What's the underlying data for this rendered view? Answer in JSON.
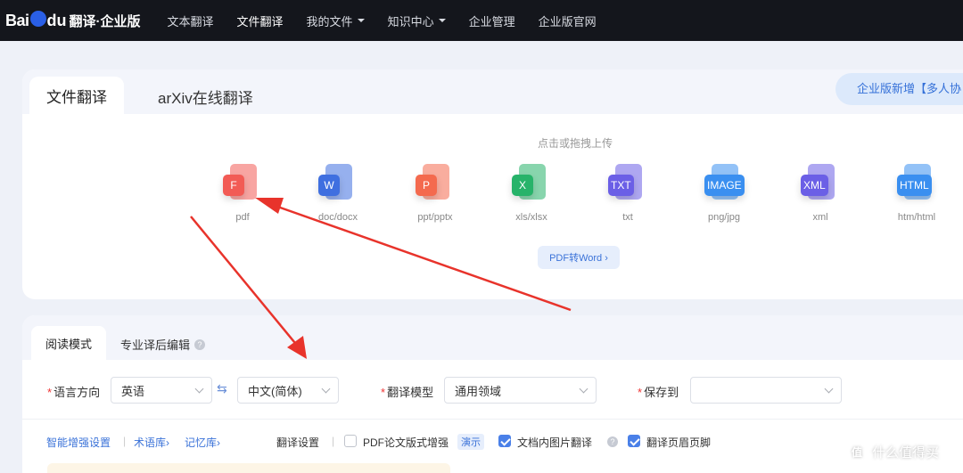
{
  "brand": {
    "prefix": "Bai",
    "suffix": "du",
    "sub": "翻译·企业版"
  },
  "nav": [
    {
      "label": "文本翻译",
      "active": false,
      "dropdown": false
    },
    {
      "label": "文件翻译",
      "active": true,
      "dropdown": false
    },
    {
      "label": "我的文件",
      "active": false,
      "dropdown": true
    },
    {
      "label": "知识中心",
      "active": false,
      "dropdown": true
    },
    {
      "label": "企业管理",
      "active": false,
      "dropdown": false
    },
    {
      "label": "企业版官网",
      "active": false,
      "dropdown": false
    }
  ],
  "upload": {
    "tabs": [
      "文件翻译",
      "arXiv在线翻译"
    ],
    "promo": "企业版新增【多人协",
    "hint": "点击或拖拽上传",
    "file_types": [
      {
        "label": "pdf",
        "glyph": "F",
        "color": "#f25b55"
      },
      {
        "label": "doc/docx",
        "glyph": "W",
        "color": "#3f6fe0"
      },
      {
        "label": "ppt/pptx",
        "glyph": "P",
        "color": "#f46a4e"
      },
      {
        "label": "xls/xlsx",
        "glyph": "X",
        "color": "#27b36a"
      },
      {
        "label": "txt",
        "glyph": "TXT",
        "color": "#6b5fe6"
      },
      {
        "label": "png/jpg",
        "glyph": "IMAGE",
        "color": "#3a8ff0"
      },
      {
        "label": "xml",
        "glyph": "XML",
        "color": "#6b5fe6"
      },
      {
        "label": "htm/html",
        "glyph": "HTML",
        "color": "#3a8ff0"
      }
    ],
    "pdf2word": "PDF转Word ›"
  },
  "settings": {
    "tabs": [
      "阅读模式",
      "专业译后编辑"
    ],
    "lang_label": "语言方向",
    "source_lang": "英语",
    "target_lang": "中文(简体)",
    "model_label": "翻译模型",
    "model_value": "通用领域",
    "save_label": "保存到",
    "save_value": "",
    "links": [
      "智能增强设置",
      "术语库›",
      "记忆库›"
    ],
    "translate_settings": "翻译设置",
    "opt_pdf": "PDF论文版式增强",
    "demo": "演示",
    "opt_image": "文档内图片翻译",
    "opt_header": "翻译页眉页脚"
  },
  "watermark": {
    "logo": "值",
    "text": "什么值得买"
  }
}
